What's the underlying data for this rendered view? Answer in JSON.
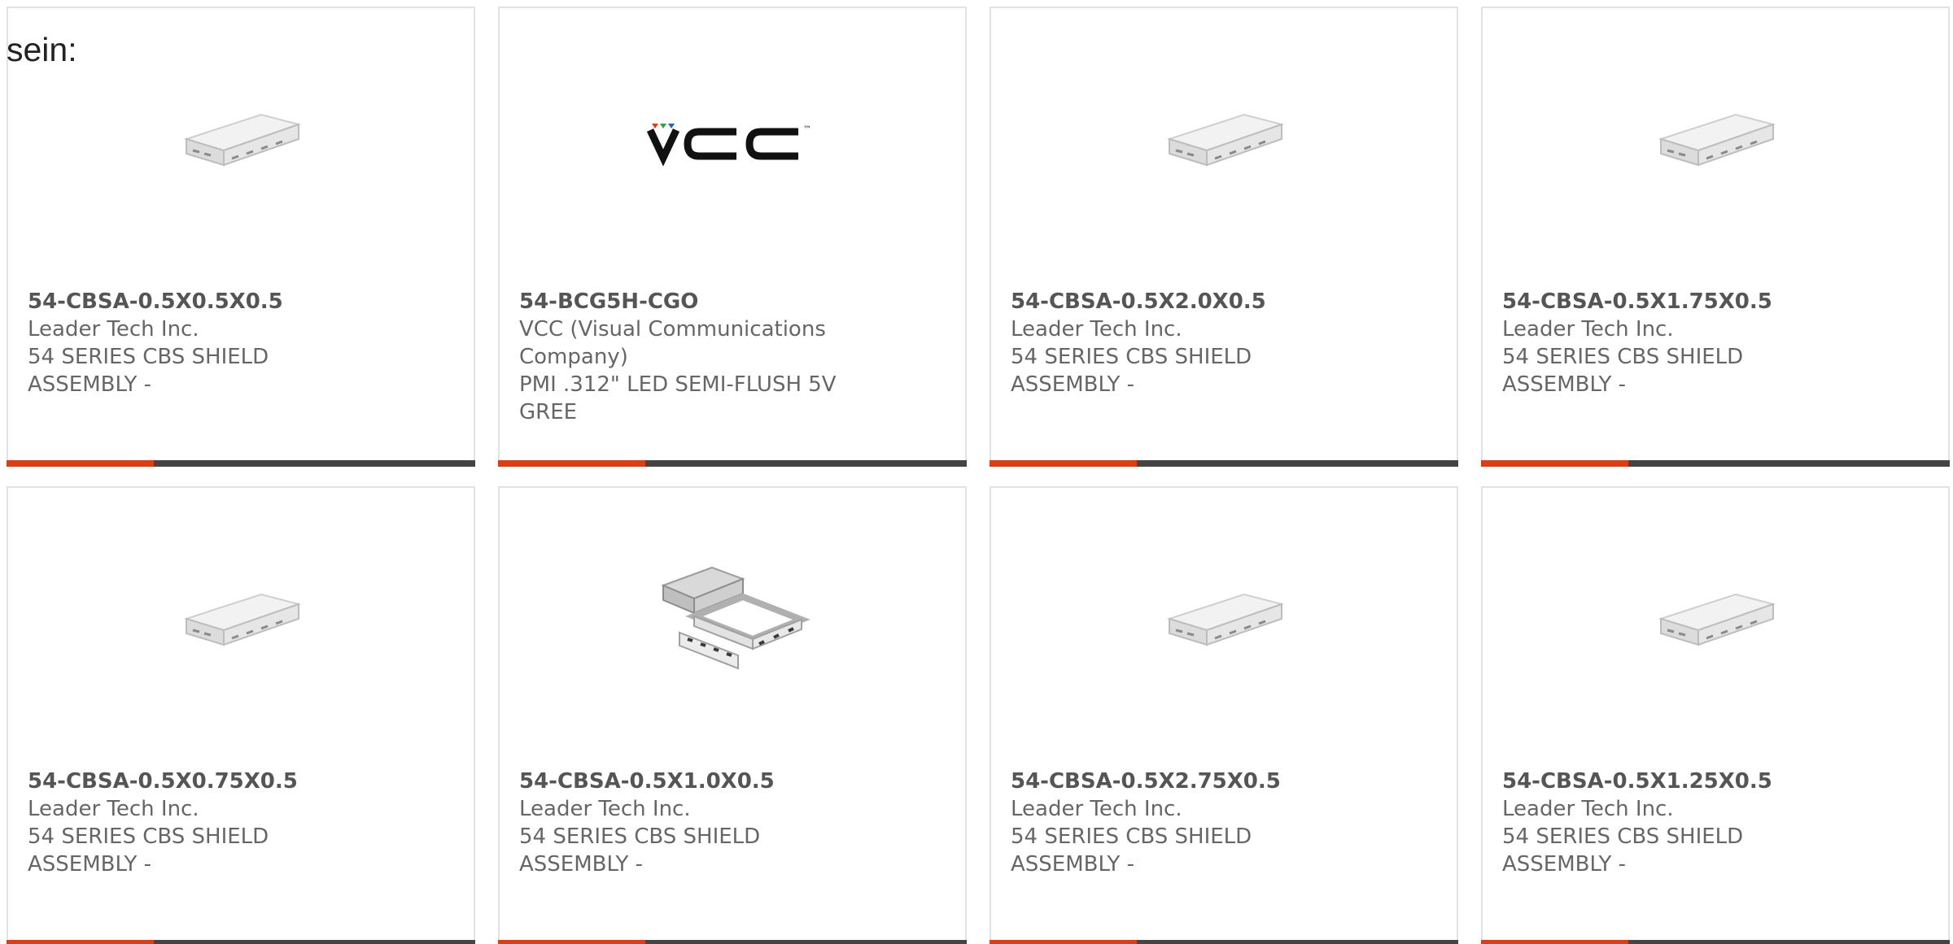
{
  "intro_text": "sein:",
  "brand": {
    "accent": "#e03c12",
    "bar": "#444444",
    "border": "#e2e2e2"
  },
  "products": [
    {
      "part_number": "54-CBSA-0.5X0.5X0.5",
      "manufacturer": "Leader Tech Inc.",
      "description": "54 SERIES CBS SHIELD ASSEMBLY -",
      "image": "shield-box-icon"
    },
    {
      "part_number": "54-BCG5H-CGO",
      "manufacturer": "VCC (Visual Communications Company)",
      "description": "PMI .312\" LED SEMI-FLUSH 5V GREE",
      "image": "vcc-logo",
      "logo_text": "VCC"
    },
    {
      "part_number": "54-CBSA-0.5X2.0X0.5",
      "manufacturer": "Leader Tech Inc.",
      "description": "54 SERIES CBS SHIELD ASSEMBLY -",
      "image": "shield-box-icon"
    },
    {
      "part_number": "54-CBSA-0.5X1.75X0.5",
      "manufacturer": "Leader Tech Inc.",
      "description": "54 SERIES CBS SHIELD ASSEMBLY -",
      "image": "shield-box-icon"
    },
    {
      "part_number": "54-CBSA-0.5X0.75X0.5",
      "manufacturer": "Leader Tech Inc.",
      "description": "54 SERIES CBS SHIELD ASSEMBLY -",
      "image": "shield-box-icon"
    },
    {
      "part_number": "54-CBSA-0.5X1.0X0.5",
      "manufacturer": "Leader Tech Inc.",
      "description": "54 SERIES CBS SHIELD ASSEMBLY -",
      "image": "shield-frame-icon"
    },
    {
      "part_number": "54-CBSA-0.5X2.75X0.5",
      "manufacturer": "Leader Tech Inc.",
      "description": "54 SERIES CBS SHIELD ASSEMBLY -",
      "image": "shield-box-icon"
    },
    {
      "part_number": "54-CBSA-0.5X1.25X0.5",
      "manufacturer": "Leader Tech Inc.",
      "description": "54 SERIES CBS SHIELD ASSEMBLY -",
      "image": "shield-box-icon"
    }
  ]
}
